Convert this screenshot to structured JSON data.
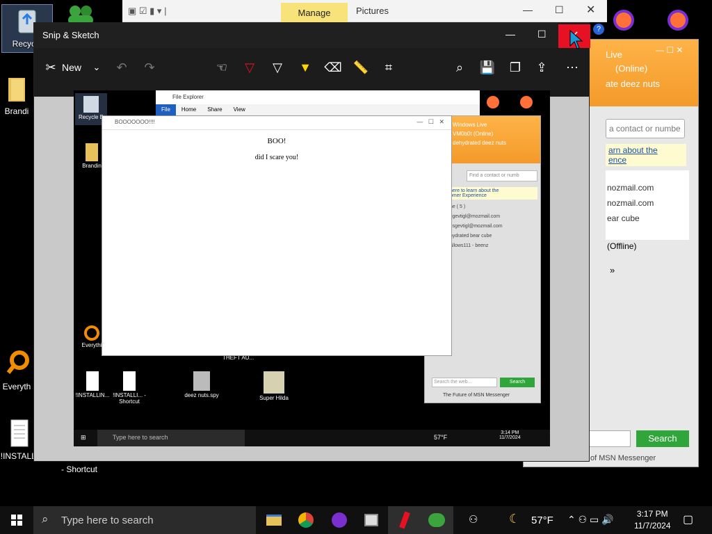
{
  "desktop": {
    "icons": [
      {
        "label": "Recycle"
      },
      {
        "label": "Brandi"
      },
      {
        "label": "Everyth"
      },
      {
        "label": "!INSTALLI"
      },
      {
        "label": "- Shortcut"
      }
    ]
  },
  "explorer_bar": {
    "manage_label": "Manage",
    "title": "Pictures"
  },
  "messenger": {
    "header_title": "Live",
    "status": "(Online)",
    "tagline": "ate deez nuts",
    "search_placeholder": "a contact or numbe",
    "promo_line1": "arn about the",
    "promo_line2": "ence",
    "contacts": [
      "nozmail.com",
      "nozmail.com",
      "ear cube"
    ],
    "offline_label": "(Offline)",
    "more": "»",
    "search_button": "Search",
    "footer": "of MSN Messenger"
  },
  "snip": {
    "title": "Snip & Sketch",
    "new_label": "New",
    "colors": {
      "accent_red": "#e81123",
      "highlighter": "#ffd400"
    }
  },
  "inner_shot": {
    "explorer_title": "File Explorer",
    "ribbon": [
      "File",
      "Home",
      "Share",
      "View"
    ],
    "popup": {
      "title": "BOOOOOOO!!!!",
      "heading": "BOO!",
      "message": "did I scare you!"
    },
    "msn": {
      "header": "Windows Live",
      "name": "VM0b0t",
      "status": "(Online)",
      "tagline": "dehydrated deez nuts",
      "search_placeholder": "Find a contact or numb",
      "promo_line1": "here to learn about the",
      "promo_line2": "omer Experience",
      "group": "ne ( 5 )",
      "contacts": [
        "tigevtigl@mozmail.com",
        "csgevtigl@mozmail.com",
        "hydrated bear cube",
        "",
        "allows111 - beenz"
      ],
      "web_search_placeholder": "Search the web...",
      "search_button": "Search",
      "footer": "The Future of MSN Messenger"
    },
    "desktop_icons": [
      "Recycle B",
      "Brandin",
      "Everythi",
      "!INSTALLIN...",
      "!INSTALLI... - Shortcut",
      "deez nuts.spy",
      "Super Hilda",
      "THEFT AU..."
    ],
    "taskbar": {
      "search": "Type here to search",
      "weather": "57°F",
      "time": "3:14 PM",
      "date": "11/7/2024"
    }
  },
  "behind_labels": {
    "shortcut": "- Shortcut",
    "installi": "!INSTALLI"
  },
  "taskbar": {
    "search_placeholder": "Type here to search",
    "weather": "57°F",
    "time": "3:17 PM",
    "date": "11/7/2024"
  }
}
